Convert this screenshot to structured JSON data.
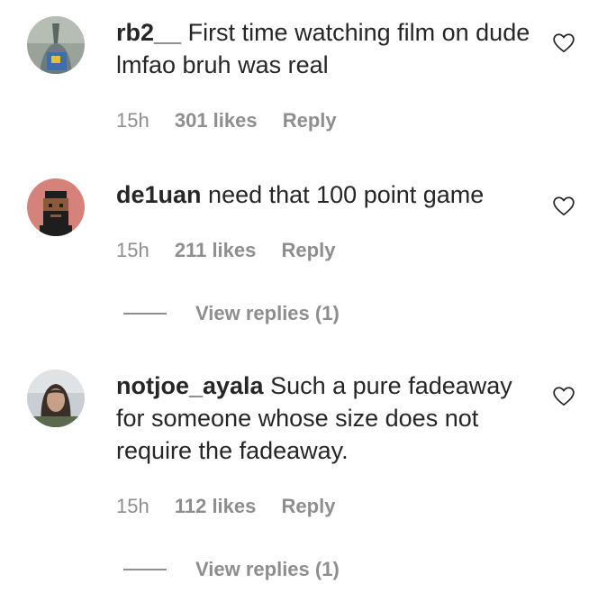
{
  "comments": [
    {
      "username": "rb2__",
      "text": "First time watching film on dude lmfao bruh was real",
      "time": "15h",
      "likes": "301 likes",
      "reply_label": "Reply"
    },
    {
      "username": "de1uan",
      "text": "need that 100 point game",
      "time": "15h",
      "likes": "211 likes",
      "reply_label": "Reply",
      "view_replies": "View replies (1)"
    },
    {
      "username": "notjoe_ayala",
      "text": "Such a pure fadeaway for someone whose size does not require the fadeaway.",
      "time": "15h",
      "likes": "112 likes",
      "reply_label": "Reply",
      "view_replies": "View replies (1)"
    }
  ],
  "colors": {
    "text": "#262626",
    "secondary": "#8e8e8e",
    "background": "#ffffff"
  },
  "icons": {
    "like": "heart-outline-icon"
  }
}
